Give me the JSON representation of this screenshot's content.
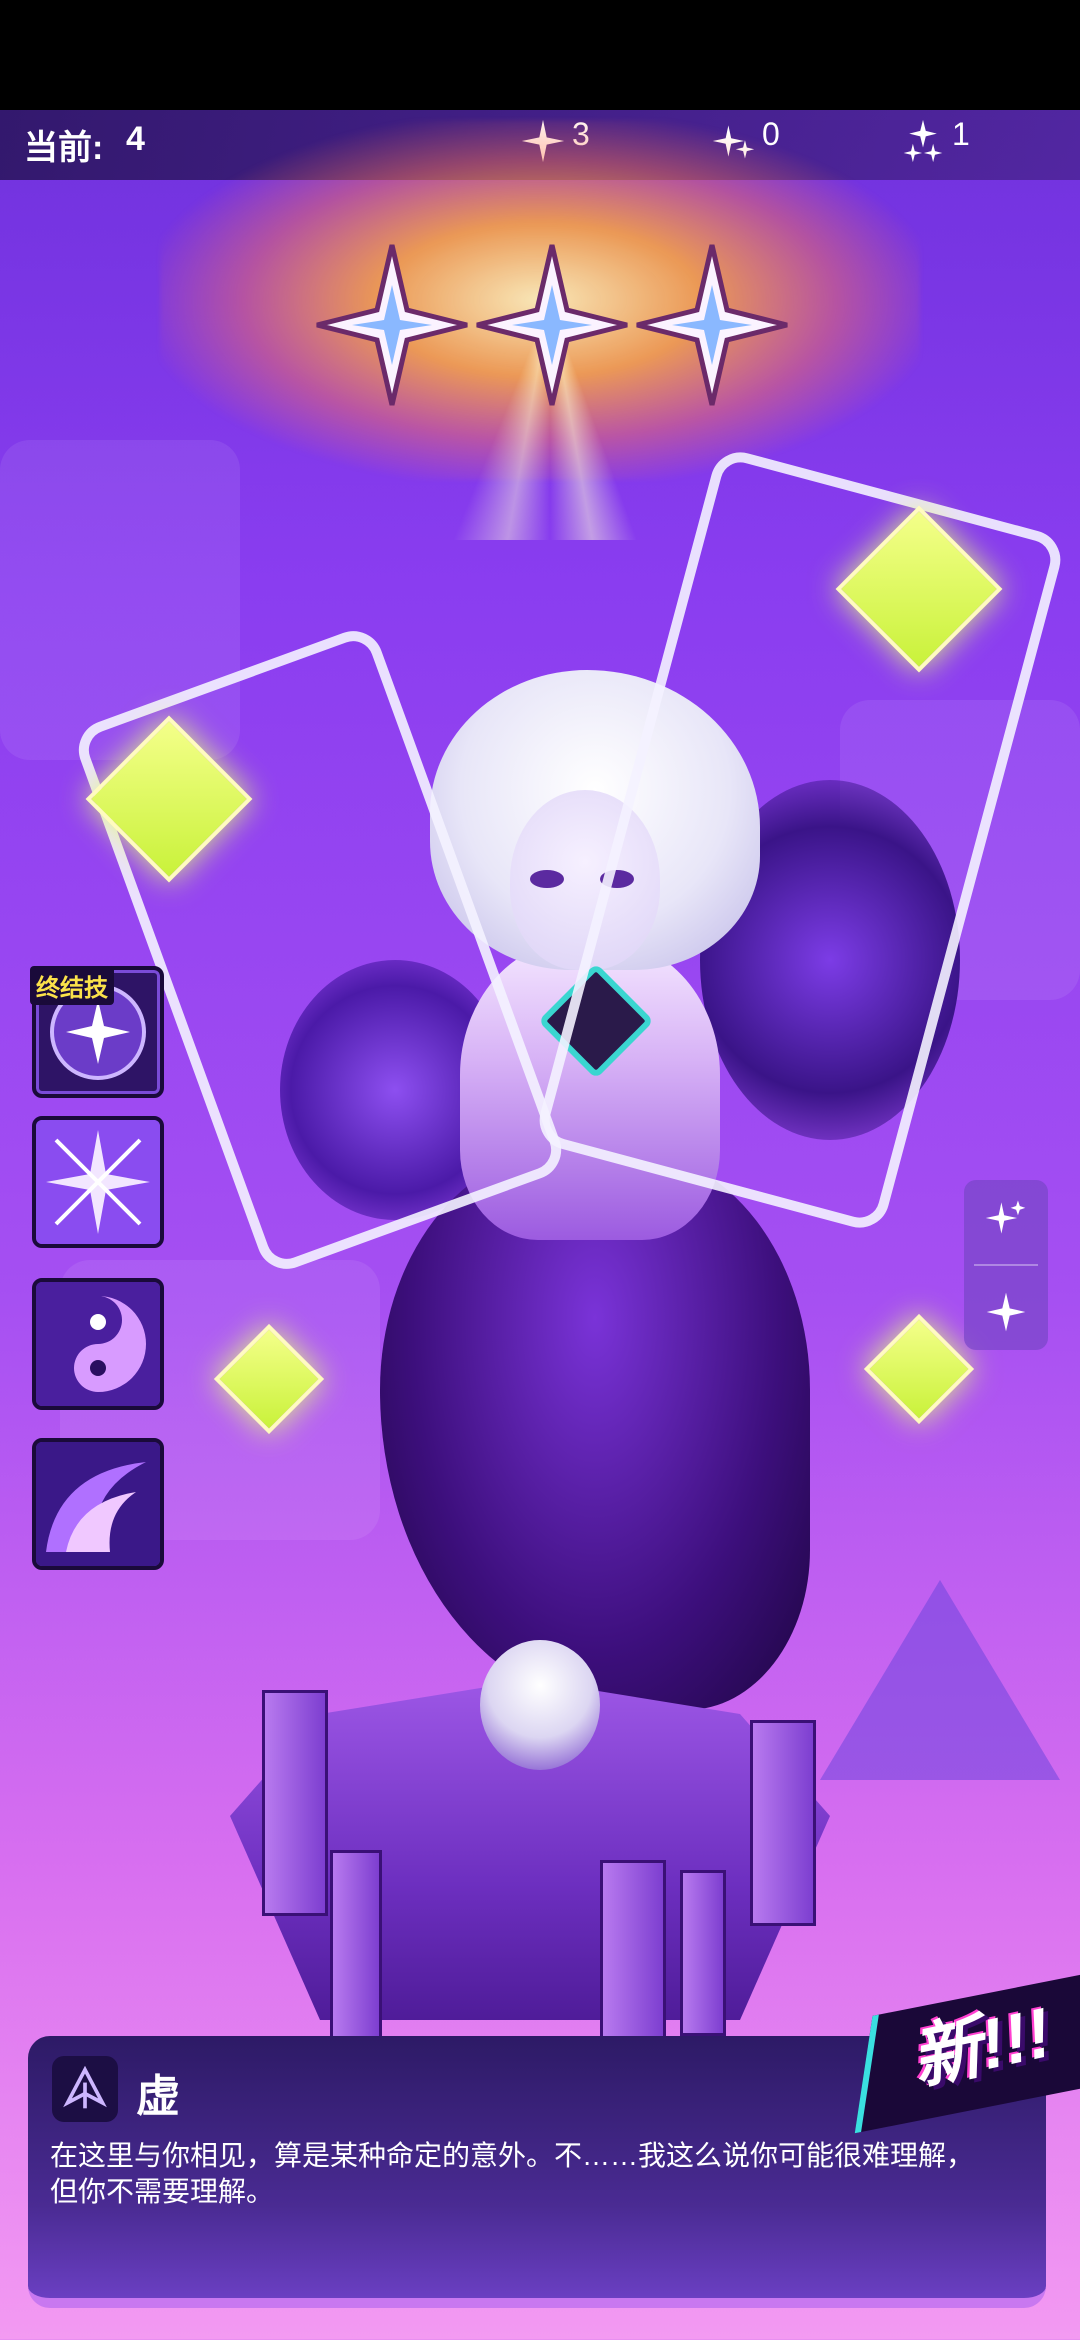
{
  "header": {
    "current_label": "当前:",
    "current_value": "4",
    "star_counts": [
      {
        "icon": "single-star-icon",
        "value": "3"
      },
      {
        "icon": "double-star-icon",
        "value": "0"
      },
      {
        "icon": "triple-star-icon",
        "value": "1"
      }
    ]
  },
  "rarity": {
    "stars": 3,
    "star_icon": "rarity-star-icon"
  },
  "skills": {
    "ultimate_badge": "终结技",
    "icons": [
      "ultimate-skill-icon",
      "burst-skill-icon",
      "swirl-skill-icon",
      "wave-skill-icon"
    ]
  },
  "side_panel": {
    "buttons": [
      "double-sparkle-icon",
      "sparkle-icon"
    ]
  },
  "dialog": {
    "name": "虚",
    "text_line1": "在这里与你相见，算是某种命定的意外。不……我这么说你可能很难理解，",
    "text_line2": "但你不需要理解。"
  },
  "new_badge": "新!!!",
  "colors": {
    "accent": "#c878f0",
    "dialog_bg": "#2d1a66",
    "badge_yellow": "#fbe24a"
  }
}
